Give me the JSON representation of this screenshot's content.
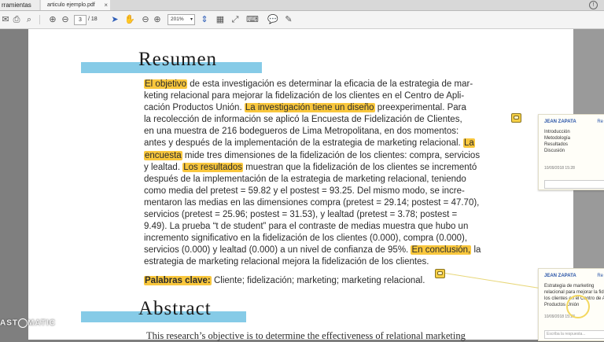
{
  "tabs": {
    "tools_label": "rramientas",
    "document_label": "articulo ejemplo.pdf",
    "close_glyph": "×",
    "help_glyph": "!"
  },
  "toolbar": {
    "current_page": "3",
    "page_total": "/ 18",
    "zoom": "201%"
  },
  "document": {
    "heading": "Resumen",
    "abstract_heading": "Abstract",
    "lines": [
      {
        "pre": "",
        "hl": "El objetivo",
        "post": " de esta investigación es determinar la eficacia de la estrategia de mar-"
      },
      {
        "pre": "keting relacional para mejorar la fidelización de los clientes en el Centro de Apli-",
        "hl": "",
        "post": ""
      },
      {
        "pre": "cación Productos Unión. ",
        "hl": "La investigación tiene un diseño",
        "post": " preexperimental. Para"
      },
      {
        "pre": "la recolección de información se aplicó la Encuesta de Fidelización de Clientes,",
        "hl": "",
        "post": ""
      },
      {
        "pre": "en una muestra de 216 bodegueros de Lima Metropolitana, en dos momentos:",
        "hl": "",
        "post": ""
      },
      {
        "pre": "antes y después de la implementación de la estrategia de marketing relacional. ",
        "hl": "La",
        "post": ""
      },
      {
        "pre": "",
        "hl": "encuesta",
        "post": " mide tres dimensiones de la fidelización de los clientes: compra, servicios"
      },
      {
        "pre": "y lealtad. ",
        "hl": "Los resultados",
        "post": " muestran que la fidelización de los clientes se incrementó"
      },
      {
        "pre": "después de la implementación de la estrategia de marketing relacional, teniendo",
        "hl": "",
        "post": ""
      },
      {
        "pre": "como media del pretest = 59.82 y el postest = 93.25. Del mismo modo, se incre-",
        "hl": "",
        "post": ""
      },
      {
        "pre": "mentaron las medias en las dimensiones compra (pretest = 29.14; postest = 47.70),",
        "hl": "",
        "post": ""
      },
      {
        "pre": "servicios (pretest = 25.96; postest = 31.53), y lealtad (pretest = 3.78; postest =",
        "hl": "",
        "post": ""
      },
      {
        "pre": "9.49). La prueba “t de student” para el contraste de medias muestra que hubo un",
        "hl": "",
        "post": ""
      },
      {
        "pre": "incremento significativo en la fidelización de los clientes (0.000), compra (0.000),",
        "hl": "",
        "post": ""
      },
      {
        "pre": "servicios (0.000) y lealtad (0.000) a un nivel de confianza de 95%. ",
        "hl": "En conclusión,",
        "post": " la"
      },
      {
        "pre": "estrategia de marketing relacional mejora la fidelización de los clientes.",
        "hl": "",
        "post": ""
      }
    ],
    "keywords_label": "Palabras clave:",
    "keywords_text": " Cliente; fidelización; marketing; marketing relacional.",
    "abstract_line": "This research’s objective is to determine the effectiveness of relational marketing"
  },
  "comments": [
    {
      "author": "JEAN ZAPATA",
      "reply_link": "Re",
      "body": "Introducción\nMetodología\nResultados\nDiscusión",
      "timestamp": "10/09/2018 15:28"
    },
    {
      "author": "JEAN ZAPATA",
      "reply_link": "Re",
      "body": "Estrategia de marketing\nrelacional para mejorar la fideliz\nlos clientes en el Centro de Apli\nProductos Unión",
      "timestamp": "10/09/2018 15:23",
      "reply_placeholder": "Escriba la respuesta..."
    }
  ],
  "watermark": {
    "left": "AST",
    "right": "MATIC",
    "top": "≡"
  },
  "colors": {
    "highlight": "#f9c73d",
    "title_bar": "#86cbe7",
    "link_blue": "#2a55a8"
  }
}
